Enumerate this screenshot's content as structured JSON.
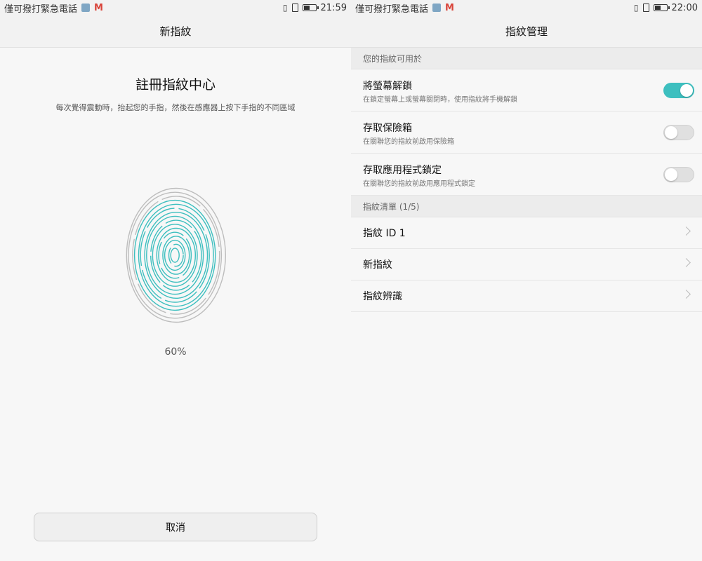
{
  "left": {
    "status": {
      "carrier": "僅可撥打緊急電話",
      "time": "21:59",
      "battery_level": 0.5
    },
    "title": "新指紋",
    "enroll_title": "註冊指紋中心",
    "enroll_subtitle": "每次覺得震動時，抬起您的手指，然後在感應器上按下手指的不同區域",
    "progress": "60%",
    "progress_value": 0.6,
    "cancel_label": "取消",
    "accent": "#3dbfbf"
  },
  "right": {
    "status": {
      "carrier": "僅可撥打緊急電話",
      "time": "22:00",
      "battery_level": 0.5
    },
    "title": "指紋管理",
    "usage_header": "您的指紋可用於",
    "toggles": [
      {
        "title": "將螢幕解鎖",
        "subtitle": "在鎖定螢幕上或螢幕關閉時，使用指紋將手機解鎖",
        "on": true
      },
      {
        "title": "存取保險箱",
        "subtitle": "在關聯您的指紋前啟用保險箱",
        "on": false
      },
      {
        "title": "存取應用程式鎖定",
        "subtitle": "在關聯您的指紋前啟用應用程式鎖定",
        "on": false
      }
    ],
    "list_header": "指紋清單 (1/5)",
    "list_items": [
      "指紋 ID 1",
      "新指紋",
      "指紋辨識"
    ]
  }
}
